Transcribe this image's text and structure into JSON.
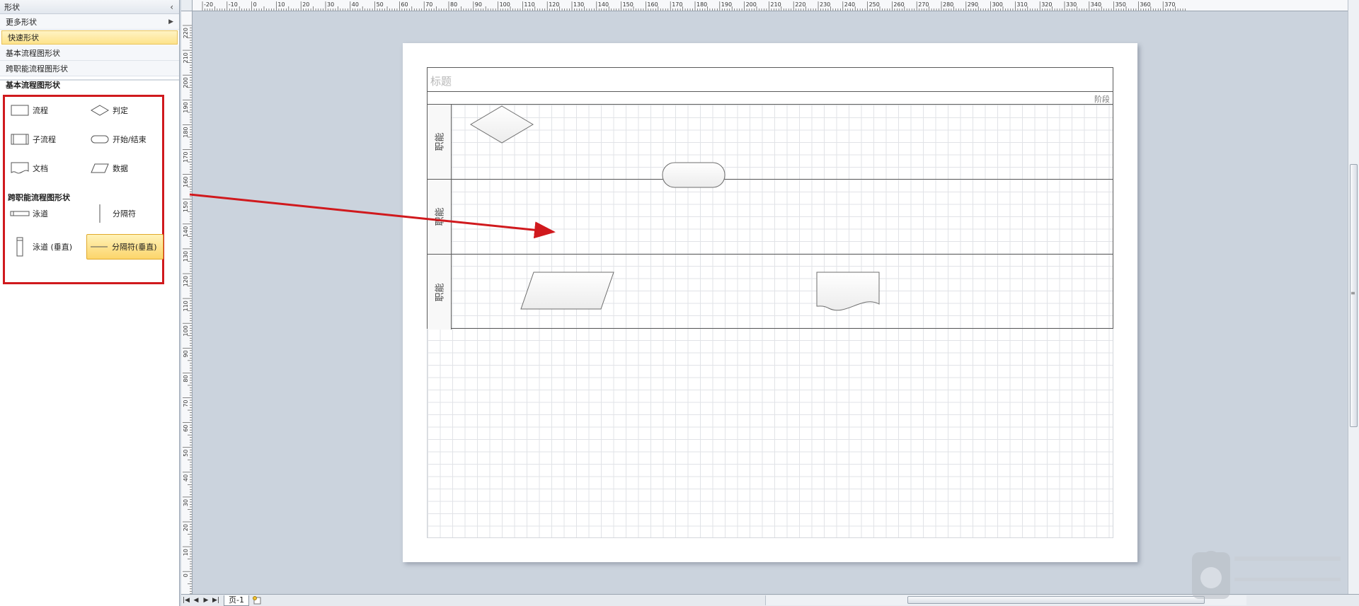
{
  "shapes_pane": {
    "title": "形状",
    "stencils": [
      {
        "label": "更多形状",
        "has_arrow": true
      },
      {
        "label": "快速形状",
        "active": true
      },
      {
        "label": "基本流程图形状"
      },
      {
        "label": "跨职能流程图形状"
      }
    ],
    "section_title": "基本流程图形状",
    "basic_masters": [
      {
        "label": "流程",
        "icon": "process-shape-icon"
      },
      {
        "label": "判定",
        "icon": "decision-shape-icon"
      },
      {
        "label": "子流程",
        "icon": "subprocess-shape-icon"
      },
      {
        "label": "开始/结束",
        "icon": "start-end-shape-icon"
      },
      {
        "label": "文档",
        "icon": "document-shape-icon"
      },
      {
        "label": "数据",
        "icon": "data-shape-icon"
      }
    ],
    "cff_group_title": "跨职能流程图形状",
    "cff_masters": [
      {
        "label": "泳道",
        "icon": "swimlane-shape-icon"
      },
      {
        "label": "分隔符",
        "icon": "separator-shape-icon"
      },
      {
        "label": "泳道 (垂直)",
        "icon": "vertical-swimlane-shape-icon"
      },
      {
        "label": "分隔符(垂直)",
        "icon": "vertical-separator-shape-icon",
        "selected": true
      }
    ]
  },
  "ruler_top": {
    "labels": [
      "-20",
      "-10",
      "0",
      "10",
      "20",
      "30",
      "40",
      "50",
      "60",
      "70",
      "80",
      "90",
      "100",
      "110",
      "120",
      "130",
      "140",
      "150",
      "160",
      "170",
      "180",
      "190",
      "200",
      "210",
      "220",
      "230",
      "240",
      "250",
      "260",
      "270",
      "280",
      "290",
      "300",
      "310",
      "320",
      "330",
      "340",
      "350",
      "360",
      "370"
    ]
  },
  "ruler_left": {
    "labels": [
      "220",
      "210",
      "200",
      "190",
      "180",
      "170",
      "160",
      "150",
      "140",
      "130",
      "120",
      "110",
      "100",
      "90",
      "80",
      "70",
      "60",
      "50",
      "40",
      "30",
      "20",
      "10",
      "0"
    ]
  },
  "diagram": {
    "title": "标题",
    "phase": "阶段",
    "lanes": [
      "职能",
      "职能",
      "职能"
    ]
  },
  "bottom_bar": {
    "page_tab": "页-1"
  },
  "colors": {
    "annotation_red": "#d0191d",
    "selection_yellow": "#fcd56b"
  }
}
